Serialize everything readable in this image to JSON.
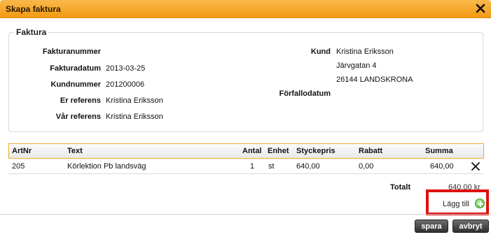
{
  "dialog": {
    "title": "Skapa faktura",
    "close_icon": "close-icon"
  },
  "section": {
    "legend": "Faktura"
  },
  "invoice": {
    "fakturanummer_label": "Fakturanummer",
    "fakturanummer_value": "",
    "fakturadatum_label": "Fakturadatum",
    "fakturadatum_value": "2013-03-25",
    "kundnummer_label": "Kundnummer",
    "kundnummer_value": "201200006",
    "er_referens_label": "Er referens",
    "er_referens_value": "Kristina Eriksson",
    "var_referens_label": "Vår referens",
    "var_referens_value": "Kristina Eriksson",
    "kund_label": "Kund",
    "kund_name": "Kristina Eriksson",
    "kund_street": "Järvgatan 4",
    "kund_city": "26144 LANDSKRONA",
    "forfallodatum_label": "Förfallodatum",
    "forfallodatum_value": ""
  },
  "table": {
    "headers": [
      "ArtNr",
      "Text",
      "Antal",
      "Enhet",
      "Styckepris",
      "Rabatt",
      "Summa"
    ],
    "rows": [
      {
        "artnr": "205",
        "text": "Körlektion Pb landsväg",
        "antal": "1",
        "enhet": "st",
        "styckepris": "640,00",
        "rabatt": "0,00",
        "summa": "640,00",
        "delete_icon": "close-icon"
      }
    ]
  },
  "totals": {
    "label": "Totalt",
    "value": "640,00 kr"
  },
  "actions": {
    "add_label": "Lägg till",
    "save_label": "spara",
    "cancel_label": "avbryt"
  }
}
